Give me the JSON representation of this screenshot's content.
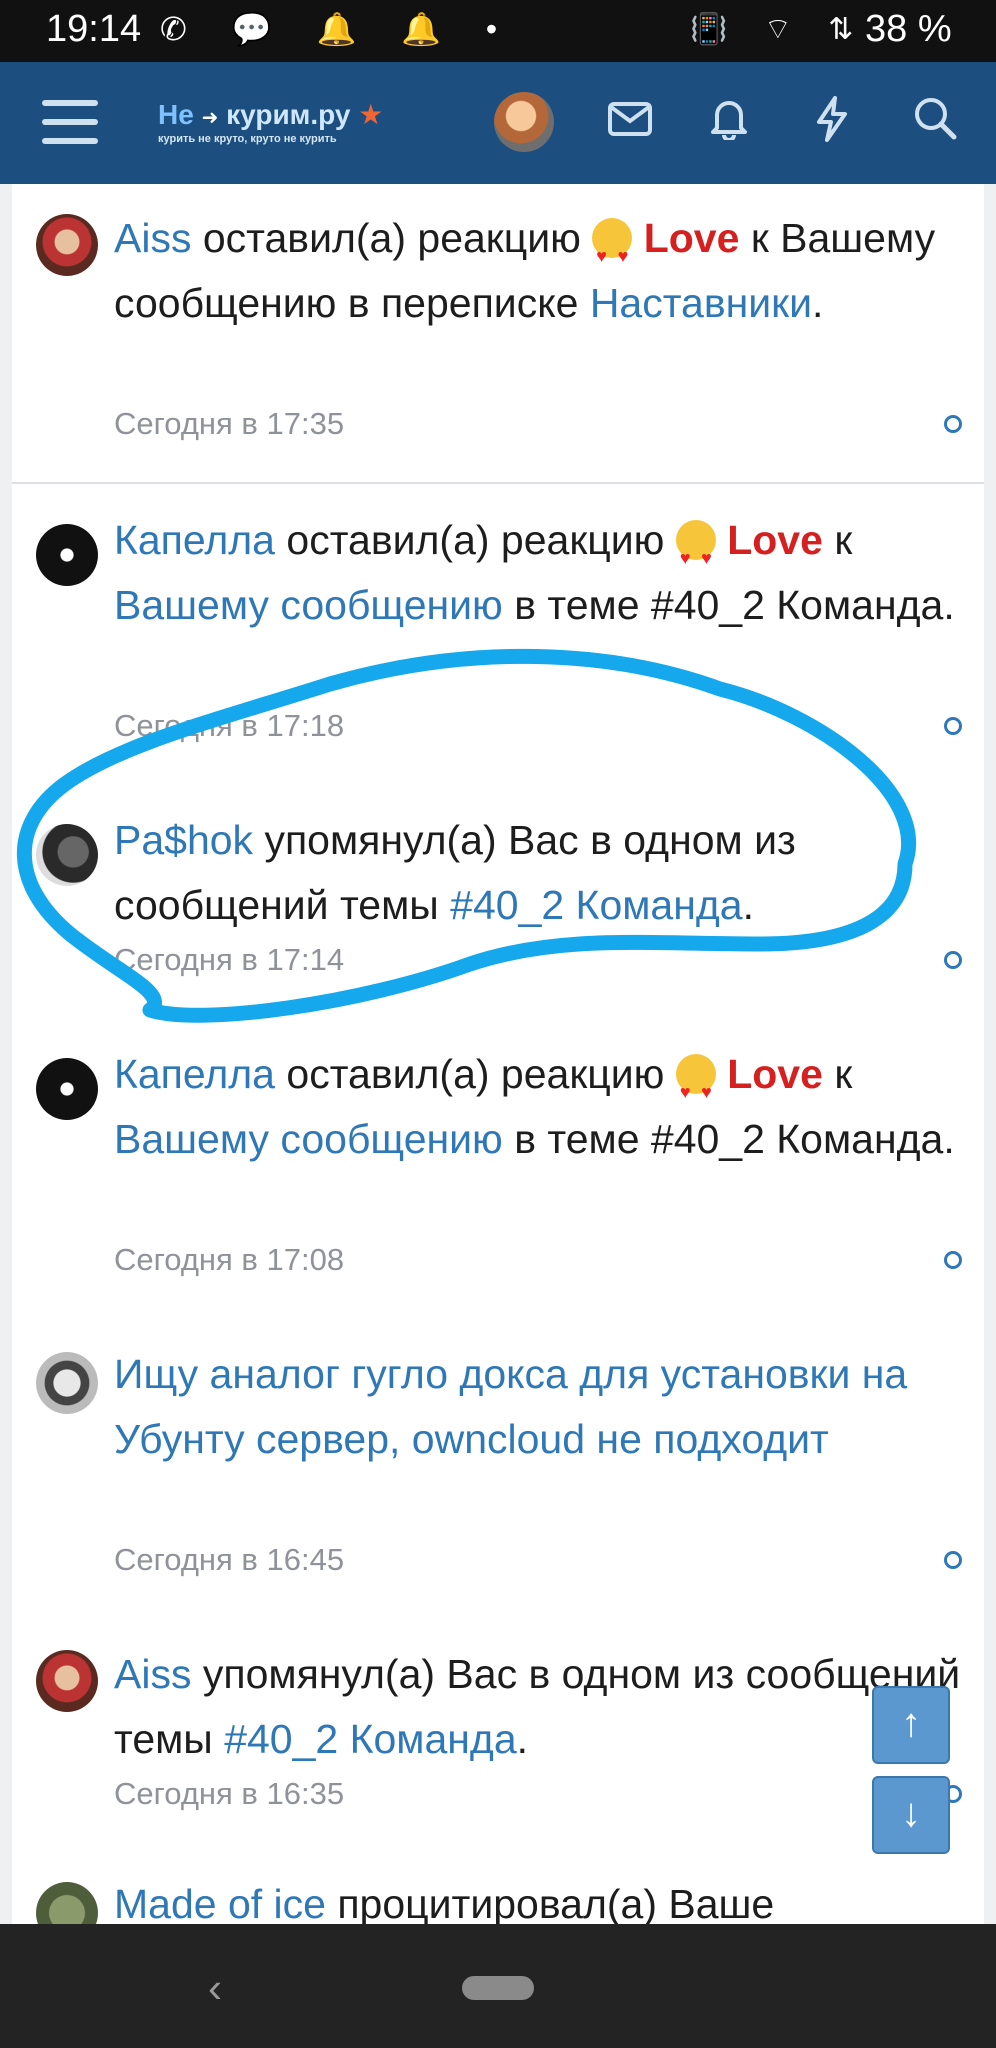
{
  "status_bar": {
    "time": "19:14",
    "left_icons": "✆ 💬 🔔 🔔 •",
    "right_icons": "📳 ⌔ ⇅",
    "battery": "38 %"
  },
  "header": {
    "logo_title_a": "Не",
    "logo_title_b": "курим.ру",
    "logo_sub": "курить не круто, круто не курить",
    "icons": [
      "menu-icon",
      "envelope-icon",
      "bell-icon",
      "bolt-icon",
      "search-icon"
    ]
  },
  "notifications": [
    {
      "user": "Aiss",
      "action": "оставил(а) реакцию",
      "reaction": "Love",
      "tail": "к Вашему сообщению в переписке",
      "link": "Наставники",
      "end": ".",
      "time": "Сегодня в 17:35"
    },
    {
      "user": "Капелла",
      "action": "оставил(а) реакцию",
      "reaction": "Love",
      "to": "к",
      "link": "Вашему сообщению",
      "tail": "в теме #40_2 Команда.",
      "time": "Сегодня в 17:18"
    },
    {
      "user": "Pa$hok",
      "action": "упомянул(а) Вас в одном из сообщений темы",
      "link": "#40_2 Команда",
      "end": ".",
      "time": "Сегодня в 17:14"
    },
    {
      "user": "Капелла",
      "action": "оставил(а) реакцию",
      "reaction": "Love",
      "to": "к",
      "link": "Вашему сообщению",
      "tail": "в теме #40_2 Команда.",
      "time": "Сегодня в 17:08"
    },
    {
      "link": "Ищу аналог гугло докса для установки на Убунту сервер, owncloud не подходит",
      "time": "Сегодня в 16:45"
    },
    {
      "user": "Aiss",
      "action": "упомянул(а) Вас в одном из сообщений темы",
      "link": "#40_2 Команда",
      "end": ".",
      "time": "Сегодня в 16:35"
    },
    {
      "user": "Made of ice",
      "action": "процитировал(а) Ваше"
    }
  ],
  "scroll": {
    "up": "↑",
    "down": "↓"
  },
  "nav": {
    "back": "‹"
  }
}
